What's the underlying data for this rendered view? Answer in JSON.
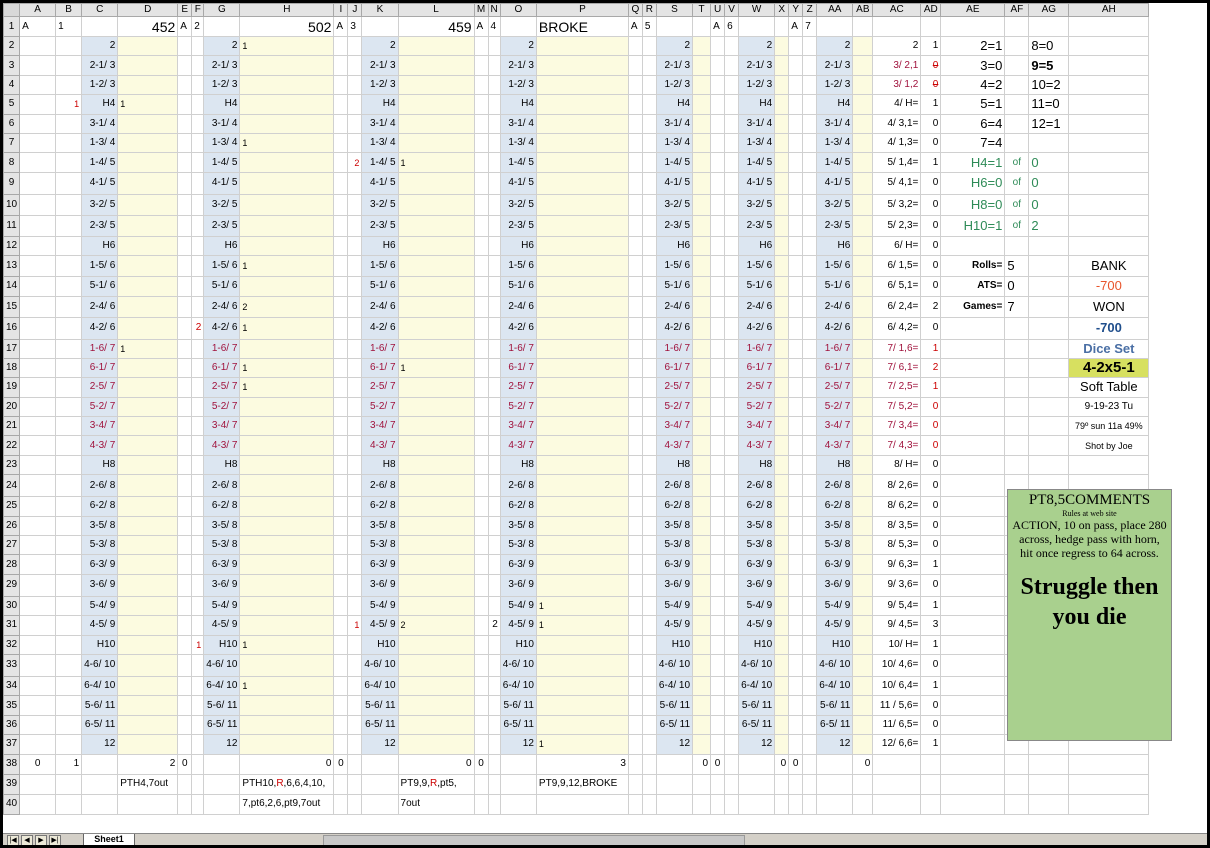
{
  "app": {
    "sheet_tab": "Sheet1"
  },
  "columns": [
    "A",
    "B",
    "C",
    "D",
    "E",
    "F",
    "G",
    "H",
    "I",
    "J",
    "K",
    "L",
    "M",
    "N",
    "O",
    "P",
    "Q",
    "R",
    "S",
    "T",
    "U",
    "V",
    "W",
    "X",
    "Y",
    "Z",
    "AA",
    "AB",
    "AC",
    "AD",
    "AE",
    "AF",
    "AG",
    "AH"
  ],
  "rows": [
    "1",
    "2",
    "3",
    "4",
    "5",
    "6",
    "7",
    "8",
    "9",
    "10",
    "11",
    "12",
    "13",
    "14",
    "15",
    "16",
    "17",
    "18",
    "19",
    "20",
    "21",
    "22",
    "23",
    "24",
    "25",
    "26",
    "27",
    "28",
    "29",
    "30",
    "31",
    "32",
    "33",
    "34",
    "35",
    "36",
    "37",
    "38",
    "39",
    "40"
  ],
  "header_row": {
    "a_labels": [
      "A",
      "A",
      "A",
      "A",
      "A",
      "A",
      "A"
    ],
    "numbers": [
      "1",
      "2",
      "3",
      "4",
      "5",
      "6",
      "7"
    ],
    "scores": [
      "452",
      "502",
      "459",
      "BROKE"
    ]
  },
  "roll_labels": [
    "2",
    "2-1/ 3",
    "1-2/ 3",
    "H4",
    "3-1/ 4",
    "1-3/ 4",
    "1-4/ 5",
    "4-1/ 5",
    "3-2/ 5",
    "2-3/ 5",
    "H6",
    "1-5/ 6",
    "5-1/ 6",
    "2-4/ 6",
    "4-2/ 6",
    "1-6/ 7",
    "6-1/ 7",
    "2-5/ 7",
    "5-2/ 7",
    "3-4/ 7",
    "4-3/ 7",
    "H8",
    "2-6/ 8",
    "6-2/ 8",
    "3-5/ 8",
    "5-3/ 8",
    "6-3/ 9",
    "3-6/ 9",
    "5-4/ 9",
    "4-5/ 9",
    "H10",
    "4-6/ 10",
    "6-4/ 10",
    "5-6/ 11",
    "6-5/ 11",
    "12"
  ],
  "d_counts": [
    "",
    "",
    "",
    "1",
    "",
    "",
    "",
    "",
    "",
    "",
    "",
    "",
    "",
    "",
    "",
    "1",
    "",
    "",
    "",
    "",
    "",
    "",
    "",
    "",
    "",
    "",
    "",
    "",
    "",
    "",
    "",
    "",
    "",
    "",
    "",
    ""
  ],
  "h_counts": [
    "1",
    "",
    "",
    "",
    "",
    "1",
    "",
    "",
    "",
    "",
    "",
    "1",
    "",
    "2",
    "1",
    "",
    "1",
    "1",
    "",
    "",
    "",
    "",
    "",
    "",
    "",
    "",
    "",
    "",
    "",
    "",
    "1",
    "",
    "1",
    "",
    "",
    ""
  ],
  "l_counts": [
    "",
    "",
    "",
    "",
    "",
    "",
    "1",
    "",
    "",
    "",
    "",
    "",
    "",
    "",
    "",
    "",
    "1",
    "",
    "",
    "",
    "",
    "",
    "",
    "",
    "",
    "",
    "",
    "",
    "",
    "2",
    "",
    "",
    "",
    "",
    "",
    ""
  ],
  "p_counts": [
    "",
    "",
    "",
    "",
    "",
    "",
    "",
    "",
    "",
    "",
    "",
    "",
    "",
    "",
    "",
    "",
    "",
    "",
    "",
    "",
    "",
    "",
    "",
    "",
    "",
    "",
    "",
    "",
    "1",
    "1",
    "",
    "",
    "",
    "",
    "",
    "1"
  ],
  "b_marks": {
    "row5": "1"
  },
  "f_marks": {
    "row16": "2",
    "row32": "1"
  },
  "j_marks": {
    "row8": "2",
    "row31": "1"
  },
  "n_marks": {
    "row31": "2"
  },
  "ac_labels": [
    "2",
    "3/ 2,1",
    "3/ 1,2",
    "4/ H=",
    "4/ 3,1=",
    "4/ 1,3=",
    "5/ 1,4=",
    "5/ 4,1=",
    "5/ 3,2=",
    "5/ 2,3=",
    "6/ H=",
    "6/ 1,5=",
    "6/ 5,1=",
    "6/ 2,4=",
    "6/ 4,2=",
    "7/ 1,6=",
    "7/ 6,1=",
    "7/ 2,5=",
    "7/ 5,2=",
    "7/ 3,4=",
    "7/ 4,3=",
    "8/ H=",
    "8/ 2,6=",
    "8/ 6,2=",
    "8/ 3,5=",
    "8/ 5,3=",
    "9/ 6,3=",
    "9/ 3,6=",
    "9/ 5,4=",
    "9/ 4,5=",
    "10/ H=",
    "10/ 4,6=",
    "10/ 6,4=",
    "11 / 5,6=",
    "11/ 6,5=",
    "12/ 6,6="
  ],
  "ad_counts": [
    "1",
    "0",
    "0",
    "1",
    "0",
    "0",
    "1",
    "0",
    "0",
    "0",
    "0",
    "0",
    "0",
    "2",
    "0",
    "1",
    "2",
    "1",
    "0",
    "0",
    "0",
    "0",
    "0",
    "0",
    "0",
    "0",
    "1",
    "0",
    "1",
    "3",
    "1",
    "0",
    "1",
    "0",
    "0",
    "1"
  ],
  "totals": {
    "a": "0",
    "b": "1",
    "d": "2",
    "e": "0",
    "h": "0",
    "i": "0",
    "l": "0",
    "m": "0",
    "p": "3",
    "s": "0",
    "u": "0",
    "w": "0",
    "y": "0",
    "ab": "0"
  },
  "summaries": {
    "d39": "PTH4,7out",
    "h39_a": "PTH10,",
    "h39_r": "R",
    "h39_b": ",6,6,4,10,",
    "h40": "7,pt6,2,6,pt9,7out",
    "l39_a": "PT9,9,",
    "l39_r": "R",
    "l39_b": ",pt5,",
    "l40": "7out",
    "p39": "PT9,9,12,BROKE"
  },
  "stats": {
    "number_counts_left": [
      "2=1",
      "3=0",
      "4=2",
      "5=1",
      "6=4",
      "7=4"
    ],
    "number_counts_right": [
      "8=0",
      "9=5",
      "10=2",
      "11=0",
      "12=1"
    ],
    "hardways": [
      {
        "label": "H4=1",
        "of": "of",
        "total": "0"
      },
      {
        "label": "H6=0",
        "of": "of",
        "total": "0"
      },
      {
        "label": "H8=0",
        "of": "of",
        "total": "0"
      },
      {
        "label": "H10=1",
        "of": "of",
        "total": "2"
      }
    ],
    "rolls_label": "Rolls=",
    "rolls_value": "5",
    "ats_label": "ATS=",
    "ats_value": "0",
    "games_label": "Games=",
    "games_value": "7"
  },
  "bank": {
    "bank_label": "BANK",
    "bank_value": "-700",
    "won_label": "WON",
    "won_value": "-700",
    "dice_set_label": "Dice Set",
    "dice_set_value": "4-2x5-1",
    "table": "Soft Table",
    "date": "9-19-23 Tu",
    "weather": "79º sun 11a 49%",
    "shooter": "Shot by Joe"
  },
  "comment": {
    "title": "PT8,5COMMENTS",
    "subtitle": "Rules at web site",
    "body_1": "ACTION, 10 on pass, place 280 across, hedge pass with horn,",
    "body_2": "hit once regress to 64 across.",
    "big": "Struggle then you die"
  },
  "colors": {
    "blue_cell": "#dce6f1",
    "yellow_cell": "#fcfbe0",
    "seven_red": "#a0123c",
    "hardway_green": "#2e8b57",
    "comment_bg": "#a9d08e",
    "dice_highlight": "#d7e060"
  }
}
